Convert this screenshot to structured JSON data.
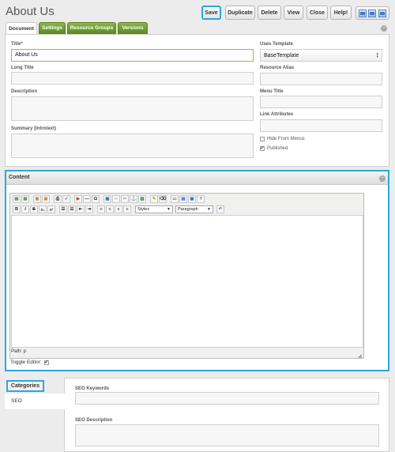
{
  "page_title": "About Us",
  "toolbar": {
    "save": "Save",
    "duplicate": "Duplicate",
    "delete": "Delete",
    "view": "View",
    "close": "Close",
    "help": "Help!"
  },
  "tabs": [
    "Document",
    "Settings",
    "Resource Groups",
    "Versions"
  ],
  "document": {
    "title_label": "Title*",
    "title_value": "About Us",
    "long_title_label": "Long Title",
    "description_label": "Description",
    "summary_label": "Summary (Introtext)",
    "uses_template_label": "Uses Template",
    "template_value": "BaseTemplate",
    "resource_alias_label": "Resource Alias",
    "menu_title_label": "Menu Title",
    "link_attributes_label": "Link Attributes",
    "hide_from_menus_label": "Hide From Menus",
    "hide_from_menus_checked": false,
    "published_label": "Published",
    "published_checked": true
  },
  "content": {
    "header": "Content",
    "styles_dropdown": "Styles",
    "format_dropdown": "Paragraph",
    "path": "Path: p",
    "toggle_editor_label": "Toggle Editor:",
    "toggle_editor_checked": true,
    "toolbar_row1_icons": [
      "paste-text-icon",
      "paste-word-icon",
      "copy-icon",
      "paste-icon",
      "print-icon",
      "spellcheck-icon",
      "media-icon",
      "hr-icon",
      "charmap-icon",
      "image-icon",
      "link-icon",
      "unlink-icon",
      "anchor-icon",
      "template-icon",
      "cleanup-icon",
      "clear-icon",
      "fullscreen-icon",
      "source-icon",
      "preview-icon",
      "help-icon"
    ],
    "toolbar_row2_icons": [
      "bold-icon",
      "italic-icon",
      "underline-icon",
      "strike-icon",
      "subscript-icon",
      "superscript-icon",
      "bullet-list-icon",
      "numbered-list-icon",
      "outdent-icon",
      "indent-icon",
      "align-left-icon",
      "align-center-icon",
      "align-right-icon",
      "justify-icon",
      "styles-dropdown",
      "format-dropdown",
      "undo-icon"
    ],
    "toolbar_row2_glyphs": {
      "bold": "B",
      "italic": "I",
      "strike": "S",
      "subscript": "X₂",
      "superscript": "X²"
    }
  },
  "tvs": {
    "categories_label": "Categories",
    "seo_item": "SEO",
    "seo_keywords_label": "SEO Keywords",
    "seo_description_label": "SEO Description"
  },
  "colors": {
    "accent_blue": "#29a8e0",
    "tab_green": "#6b9a2c",
    "title_input_border": "#8cc14a"
  }
}
